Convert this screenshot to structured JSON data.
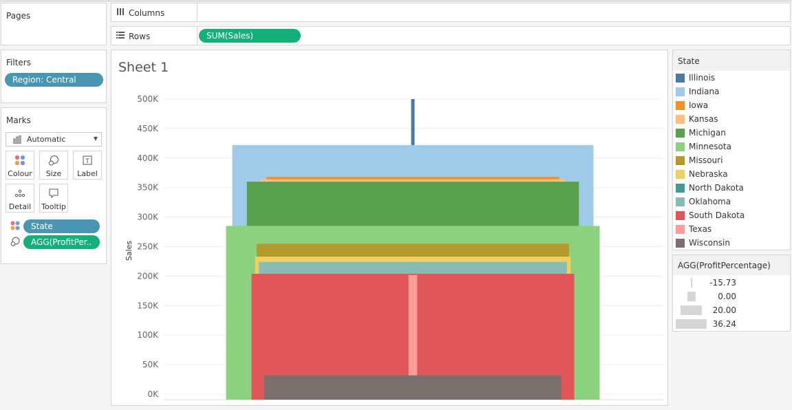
{
  "pages": {
    "title": "Pages"
  },
  "filters": {
    "title": "Filters",
    "pill": "Region: Central"
  },
  "marks": {
    "title": "Marks",
    "type": "Automatic",
    "buttons": {
      "colour": "Colour",
      "size": "Size",
      "label": "Label",
      "detail": "Detail",
      "tooltip": "Tooltip"
    },
    "pill_state": "State",
    "pill_profit": "AGG(ProfitPer.."
  },
  "shelves": {
    "columns_label": "Columns",
    "rows_label": "Rows",
    "rows_pill": "SUM(Sales)"
  },
  "sheet": {
    "title": "Sheet 1"
  },
  "legend": {
    "title": "State",
    "items": [
      {
        "name": "Illinois",
        "color": "#4e79a7"
      },
      {
        "name": "Indiana",
        "color": "#a0cbe8"
      },
      {
        "name": "Iowa",
        "color": "#f28e2b"
      },
      {
        "name": "Kansas",
        "color": "#ffbe7d"
      },
      {
        "name": "Michigan",
        "color": "#59a14f"
      },
      {
        "name": "Minnesota",
        "color": "#8cd17d"
      },
      {
        "name": "Missouri",
        "color": "#b6992d"
      },
      {
        "name": "Nebraska",
        "color": "#f1ce63"
      },
      {
        "name": "North Dakota",
        "color": "#499894"
      },
      {
        "name": "Oklahoma",
        "color": "#86bcb6"
      },
      {
        "name": "South Dakota",
        "color": "#e15759"
      },
      {
        "name": "Texas",
        "color": "#ff9d9a"
      },
      {
        "name": "Wisconsin",
        "color": "#79706e"
      }
    ]
  },
  "size_legend": {
    "title": "AGG(ProfitPercentage)",
    "values": [
      "-15.73",
      "0.00",
      "20.00",
      "36.24"
    ]
  },
  "chart_data": {
    "type": "bar",
    "ylabel": "Sales",
    "ylim": [
      0,
      520000
    ],
    "yticks": [
      "0K",
      "50K",
      "100K",
      "150K",
      "200K",
      "250K",
      "300K",
      "350K",
      "400K",
      "450K",
      "500K"
    ],
    "ytick_values": [
      0,
      50000,
      100000,
      150000,
      200000,
      250000,
      300000,
      350000,
      400000,
      450000,
      500000
    ],
    "size_encoding": "AGG(ProfitPercentage)",
    "bars": [
      {
        "state": "Illinois",
        "sales": 500000,
        "profit_pct": -15.73
      },
      {
        "state": "Indiana",
        "sales": 422000,
        "profit_pct": 34.5
      },
      {
        "state": "Iowa",
        "sales": 368000,
        "profit_pct": 24.9
      },
      {
        "state": "Kansas",
        "sales": 364000,
        "profit_pct": 26.6
      },
      {
        "state": "Michigan",
        "sales": 360000,
        "profit_pct": 30.4
      },
      {
        "state": "Minnesota",
        "sales": 285000,
        "profit_pct": 36.24
      },
      {
        "state": "Missouri",
        "sales": 255000,
        "profit_pct": 27.6
      },
      {
        "state": "Nebraska",
        "sales": 233000,
        "profit_pct": 28.1
      },
      {
        "state": "Oklahoma",
        "sales": 224000,
        "profit_pct": 27.0
      },
      {
        "state": "South Dakota",
        "sales": 204000,
        "profit_pct": 29.1
      },
      {
        "state": "Texas",
        "sales": 202000,
        "profit_pct": -15.0
      },
      {
        "state": "Wisconsin",
        "sales": 32000,
        "profit_pct": 25.5
      }
    ]
  }
}
